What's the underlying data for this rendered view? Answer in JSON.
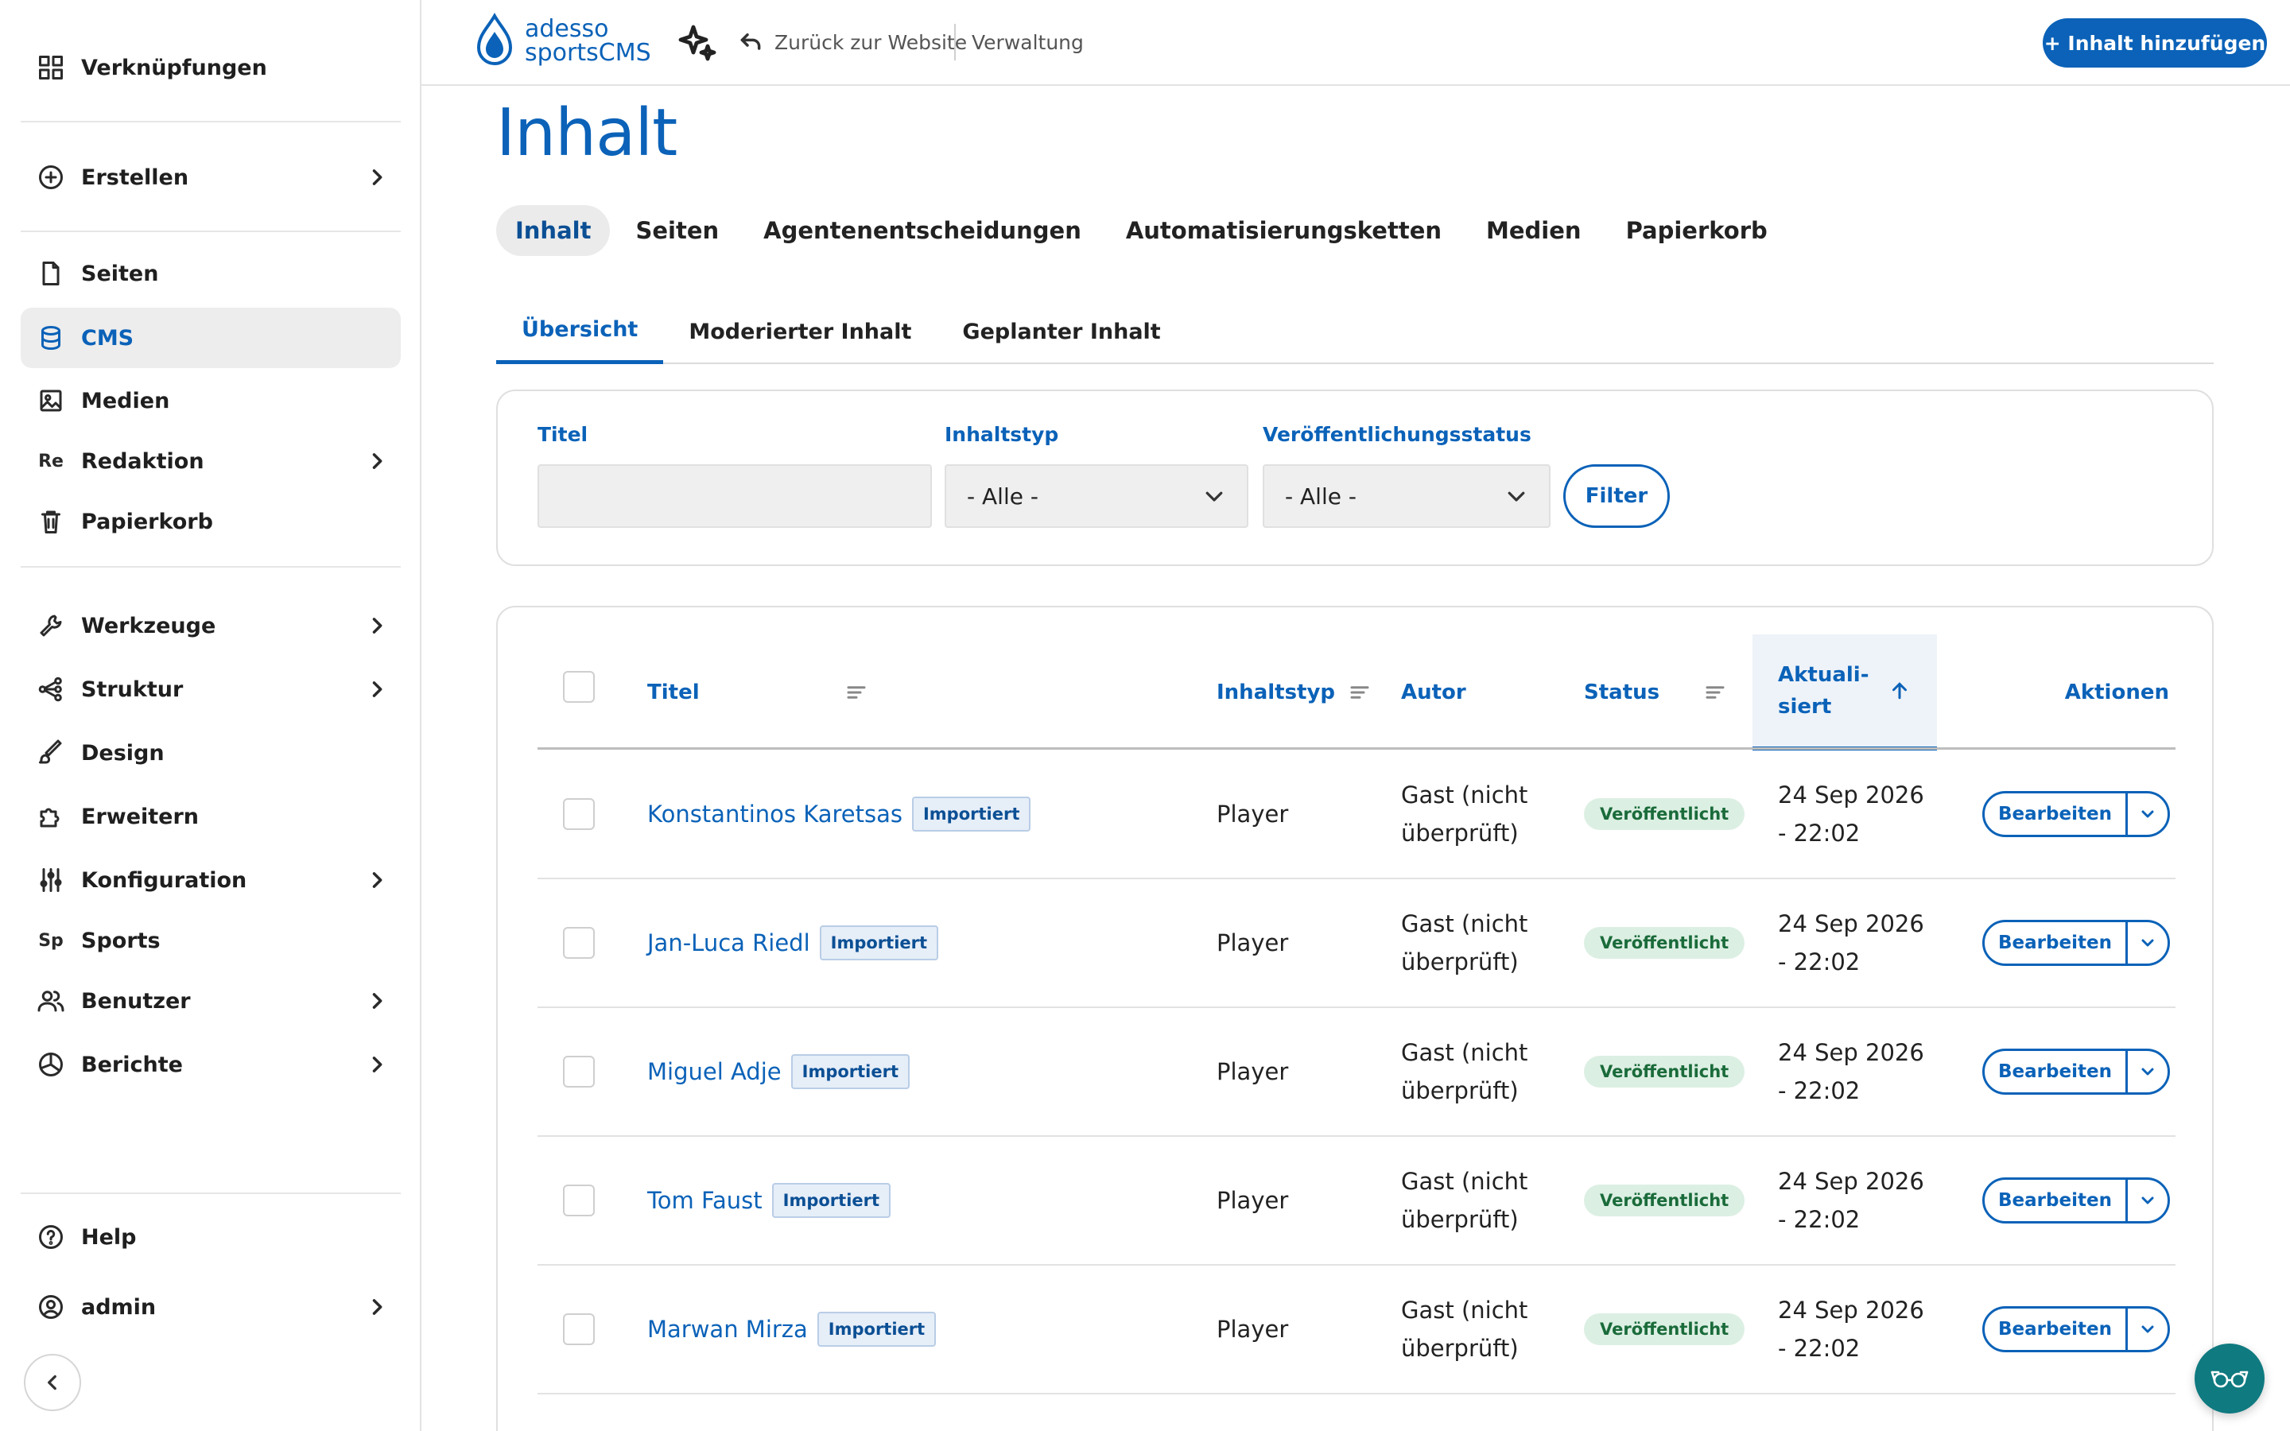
{
  "colors": {
    "accent": "#0b62b8",
    "status_published_bg": "#dcefe3",
    "badge_bg": "#e6eef8"
  },
  "sidebar": {
    "items": [
      {
        "label": "Verknüpfungen",
        "icon": "grid-layout-icon",
        "chevron": false
      },
      {
        "label": "Erstellen",
        "icon": "plus-circle-icon",
        "chevron": true
      },
      {
        "label": "Seiten",
        "icon": "page-icon",
        "chevron": false
      },
      {
        "label": "CMS",
        "icon": "database-icon",
        "chevron": false,
        "active": true
      },
      {
        "label": "Medien",
        "icon": "image-icon",
        "chevron": false
      },
      {
        "label": "Redaktion",
        "abbr": "Re",
        "chevron": true
      },
      {
        "label": "Papierkorb",
        "icon": "trash-icon",
        "chevron": false
      },
      {
        "label": "Werkzeuge",
        "icon": "wrench-icon",
        "chevron": true
      },
      {
        "label": "Struktur",
        "icon": "structure-icon",
        "chevron": true
      },
      {
        "label": "Design",
        "icon": "brush-icon",
        "chevron": false
      },
      {
        "label": "Erweitern",
        "icon": "puzzle-icon",
        "chevron": false
      },
      {
        "label": "Konfiguration",
        "icon": "sliders-icon",
        "chevron": true
      },
      {
        "label": "Sports",
        "abbr": "Sp",
        "chevron": false
      },
      {
        "label": "Benutzer",
        "icon": "users-icon",
        "chevron": true
      },
      {
        "label": "Berichte",
        "icon": "chart-pie-icon",
        "chevron": true
      },
      {
        "label": "Help",
        "icon": "help-icon",
        "chevron": false
      },
      {
        "label": "admin",
        "icon": "user-circle-icon",
        "chevron": true
      }
    ]
  },
  "topbar": {
    "logo_line1": "adesso",
    "logo_line2": "sportsCMS",
    "back_label": "Zurück zur Website",
    "admin_label": "Verwaltung",
    "add_button": "+ Inhalt hinzufügen"
  },
  "page": {
    "title": "Inhalt",
    "primary_tabs": [
      "Inhalt",
      "Seiten",
      "Agentenentscheidungen",
      "Automatisierungsketten",
      "Medien",
      "Papierkorb"
    ],
    "secondary_tabs": [
      "Übersicht",
      "Moderierter Inhalt",
      "Geplanter Inhalt"
    ]
  },
  "filters": {
    "title_label": "Titel",
    "title_value": "",
    "type_label": "Inhaltstyp",
    "type_value": "- Alle -",
    "status_label": "Veröffentlichungsstatus",
    "status_value": "- Alle -",
    "button": "Filter"
  },
  "table": {
    "headers": {
      "title": "Titel",
      "type": "Inhaltstyp",
      "author": "Autor",
      "status": "Status",
      "updated_1": "Aktuali-",
      "updated_2": "siert",
      "actions": "Aktionen"
    },
    "rows": [
      {
        "title": "Konstantinos Karetsas",
        "badge": "Importiert",
        "type": "Player",
        "author_1": "Gast (nicht",
        "author_2": "überprüft)",
        "status": "Veröffentlicht",
        "date_1": "24 Sep 2026",
        "date_2": "- 22:02",
        "action": "Bearbeiten"
      },
      {
        "title": "Jan-Luca Riedl",
        "badge": "Importiert",
        "type": "Player",
        "author_1": "Gast (nicht",
        "author_2": "überprüft)",
        "status": "Veröffentlicht",
        "date_1": "24 Sep 2026",
        "date_2": "- 22:02",
        "action": "Bearbeiten"
      },
      {
        "title": "Miguel Adje",
        "badge": "Importiert",
        "type": "Player",
        "author_1": "Gast (nicht",
        "author_2": "überprüft)",
        "status": "Veröffentlicht",
        "date_1": "24 Sep 2026",
        "date_2": "- 22:02",
        "action": "Bearbeiten"
      },
      {
        "title": "Tom Faust",
        "badge": "Importiert",
        "type": "Player",
        "author_1": "Gast (nicht",
        "author_2": "überprüft)",
        "status": "Veröffentlicht",
        "date_1": "24 Sep 2026",
        "date_2": "- 22:02",
        "action": "Bearbeiten"
      },
      {
        "title": "Marwan Mirza",
        "badge": "Importiert",
        "type": "Player",
        "author_1": "Gast (nicht",
        "author_2": "überprüft)",
        "status": "Veröffentlicht",
        "date_1": "24 Sep 2026",
        "date_2": "- 22:02",
        "action": "Bearbeiten"
      }
    ]
  },
  "fab": {
    "icon": "accessibility-glasses-icon"
  }
}
